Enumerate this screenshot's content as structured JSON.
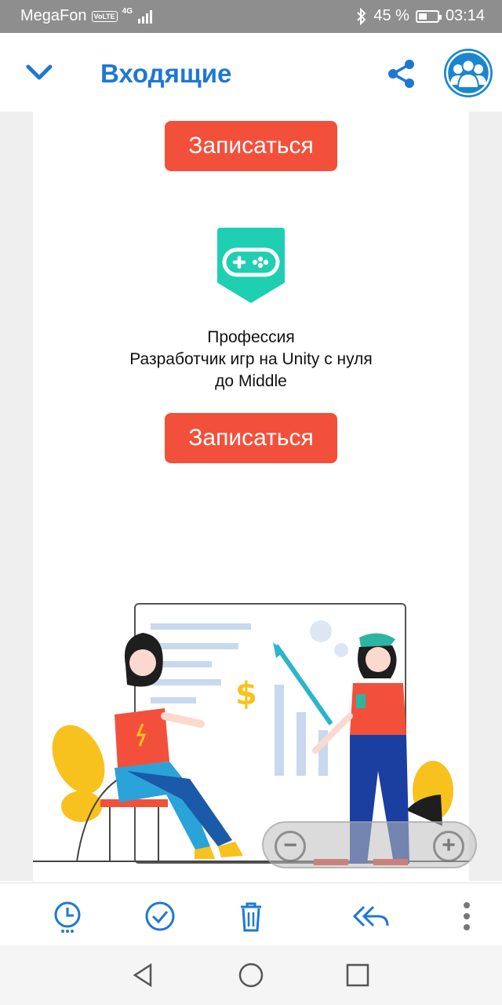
{
  "status": {
    "carrier": "MegaFon",
    "volte": "VoLTE",
    "network": "4G",
    "battery_text": "45 %",
    "battery_level": 0.45,
    "time": "03:14"
  },
  "header": {
    "title": "Входящие"
  },
  "email": {
    "button1": "Записаться",
    "course": {
      "line1": "Профессия",
      "line2": "Разработчик игр на Unity с нуля",
      "line3": "до Middle"
    },
    "button2": "Записаться"
  },
  "zoom": {
    "minus": "−",
    "plus": "+"
  },
  "colors": {
    "accent": "#1e78d2",
    "button": "#f2503b",
    "badge": "#1ecfb2"
  },
  "icons": {
    "toolbar": [
      "snooze-icon",
      "done-icon",
      "trash-icon",
      "reply-all-icon",
      "more-icon"
    ],
    "navbar": [
      "back-triangle-icon",
      "home-circle-icon",
      "recents-square-icon"
    ]
  }
}
